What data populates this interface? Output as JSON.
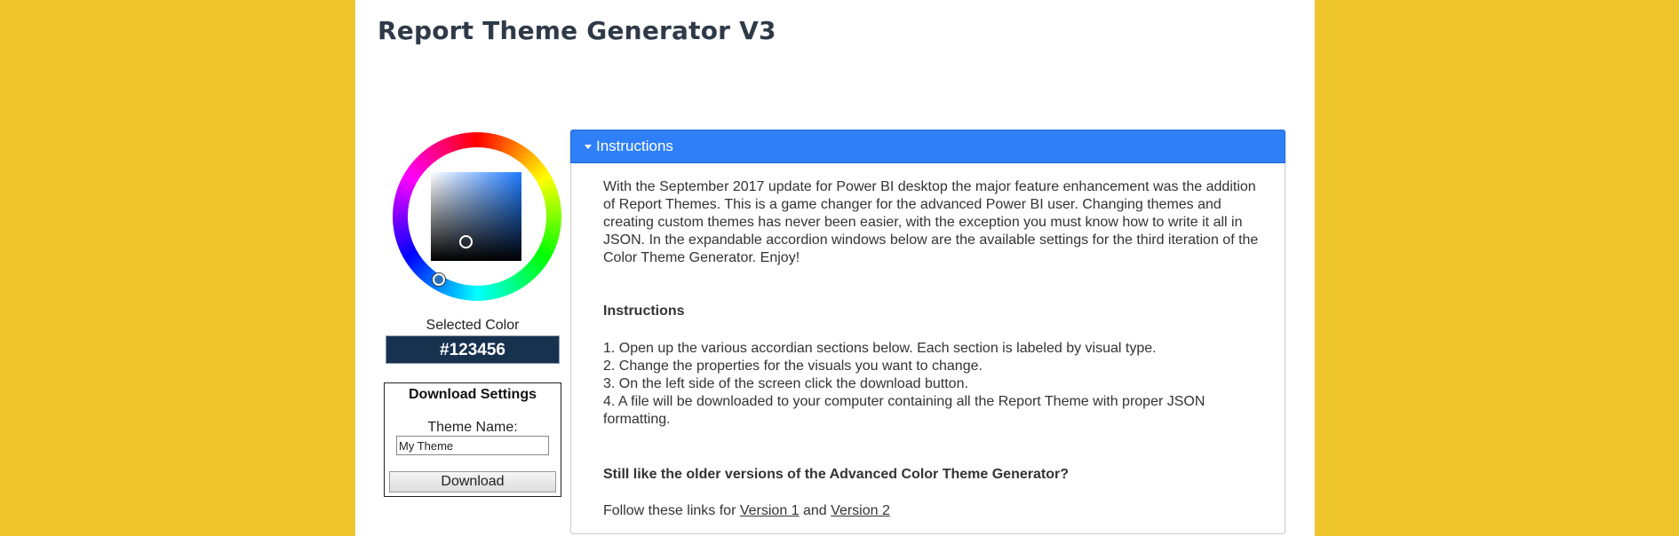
{
  "page": {
    "title": "Report Theme Generator V3"
  },
  "picker": {
    "selected_label": "Selected Color",
    "selected_value": "#123456"
  },
  "download": {
    "title": "Download Settings",
    "name_label": "Theme Name:",
    "name_value": "My Theme",
    "button_label": "Download"
  },
  "accordion": {
    "header": "Instructions",
    "intro": "With the September 2017 update for Power BI desktop the major feature enhancement was the addition of Report Themes.  This is a game changer for the advanced Power BI user.  Changing themes and creating custom themes has never been easier, with the exception you must know how to write it all in JSON.  In the expandable accordion windows below are the available settings for the third iteration of the Color Theme Generator.  Enjoy!",
    "subheading": "Instructions",
    "steps": [
      "1. Open up the various accordian sections below. Each section is labeled by visual type.",
      "2. Change the properties for the visuals you want to change.",
      "3. On the left side of the screen click the download button.",
      "4. A file will be downloaded to your computer containing all the Report Theme with proper JSON formatting."
    ],
    "older_heading": "Still like the older versions of the Advanced Color Theme Generator?",
    "links_prefix": "Follow these links for ",
    "link1": "Version 1",
    "links_and": " and ",
    "link2": "Version 2"
  },
  "colors": {
    "background": "#efc52e",
    "accent": "#2f80f8",
    "selected": "#17324f"
  }
}
